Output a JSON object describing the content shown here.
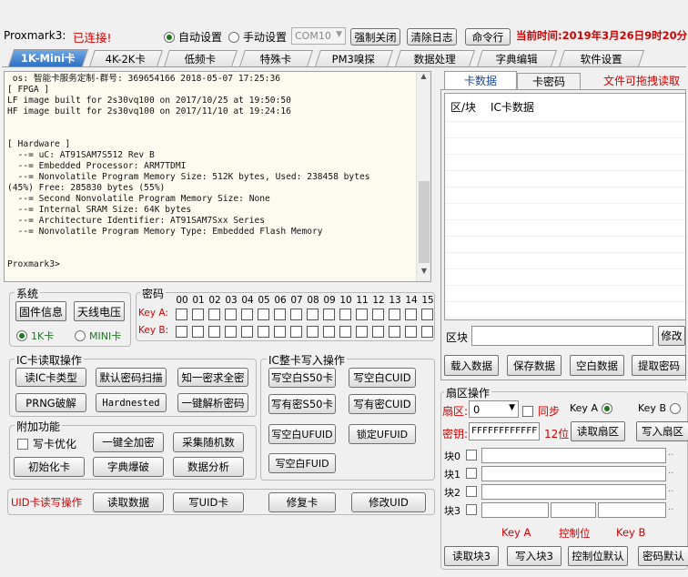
{
  "header": {
    "app": "Proxmark3:",
    "status": "已连接!",
    "auto_label": "自动设置",
    "manual_label": "手动设置",
    "com": "COM10",
    "force_close": "强制关闭",
    "clear_log": "清除日志",
    "cmd_line": "命令行",
    "time_label": "当前时间:2019年3月26日9时20分"
  },
  "tabs": [
    "1K-Mini卡",
    "4K-2K卡",
    "低频卡",
    "特殊卡",
    "PM3嗅探",
    "数据处理",
    "字典编辑",
    "软件设置"
  ],
  "console": {
    "lines": [
      " os: 智能卡服务定制-群号: 369654166 2018-05-07 17:25:36",
      "[ FPGA ]",
      "LF image built for 2s30vq100 on 2017/10/25 at 19:50:50",
      "HF image built for 2s30vq100 on 2017/11/10 at 19:24:16",
      "",
      "",
      "[ Hardware ]",
      "  --= uC: AT91SAM7S512 Rev B",
      "  --= Embedded Processor: ARM7TDMI",
      "  --= Nonvolatile Program Memory Size: 512K bytes, Used: 238458 bytes",
      "(45%) Free: 285830 bytes (55%)",
      "  --= Second Nonvolatile Program Memory Size: None",
      "  --= Internal SRAM Size: 64K bytes",
      "  --= Architecture Identifier: AT91SAM7Sxx Series",
      "  --= Nonvolatile Program Memory Type: Embedded Flash Memory",
      "",
      "",
      "Proxmark3>"
    ]
  },
  "system": {
    "title": "系统",
    "firmware": "固件信息",
    "antenna": "天线电压",
    "r1k": "1K卡",
    "rmini": "MINI卡"
  },
  "keys": {
    "title": "密码",
    "cols": [
      "00",
      "01",
      "02",
      "03",
      "04",
      "05",
      "06",
      "07",
      "08",
      "09",
      "10",
      "11",
      "12",
      "13",
      "14",
      "15"
    ],
    "keyA": "Key A:",
    "keyB": "Key B:"
  },
  "ic_read": {
    "title": "IC卡读取操作",
    "b1": "读IC卡类型",
    "b2": "默认密码扫描",
    "b3": "知一密求全密",
    "b4": "PRNG破解",
    "b5": "Hardnested",
    "b6": "一键解析密码"
  },
  "ic_write": {
    "title": "IC整卡写入操作",
    "b1": "写空白S50卡",
    "b2": "写空白CUID",
    "b3": "写有密S50卡",
    "b4": "写有密CUID",
    "b5": "写空白UFUID",
    "b6": "锁定UFUID",
    "b7": "写空白FUID"
  },
  "extra": {
    "title": "附加功能",
    "opt": "写卡优化",
    "b1": "一键全加密",
    "b2": "采集随机数",
    "b3": "初始化卡",
    "b4": "字典爆破",
    "b5": "数据分析"
  },
  "uid": {
    "label": "UID卡读写操作",
    "b1": "读取数据",
    "b2": "写UID卡",
    "b3": "修复卡",
    "b4": "修改UID"
  },
  "right": {
    "tab1": "卡数据",
    "tab2": "卡密码",
    "drag": "文件可拖拽读取",
    "col1": "区/块",
    "col2": "IC卡数据",
    "block": "区块",
    "modify": "修改",
    "load": "载入数据",
    "save": "保存数据",
    "blank": "空白数据",
    "extract": "提取密码"
  },
  "sector": {
    "title": "扇区操作",
    "sec_label": "扇区:",
    "sec_val": "0",
    "sync": "同步",
    "keyA": "Key A",
    "keyB": "Key B",
    "key_label": "密钥:",
    "key_val": "FFFFFFFFFFFF",
    "digits": "12位",
    "read": "读取扇区",
    "write": "写入扇区",
    "b0": "块0",
    "b1": "块1",
    "b2": "块2",
    "b3": "块3",
    "f_keyA": "Key A",
    "f_ctrl": "控制位",
    "f_keyB": "Key B",
    "read3": "读取块3",
    "write3": "写入块3",
    "ctrl_def": "控制位默认",
    "key_def": "密码默认"
  }
}
